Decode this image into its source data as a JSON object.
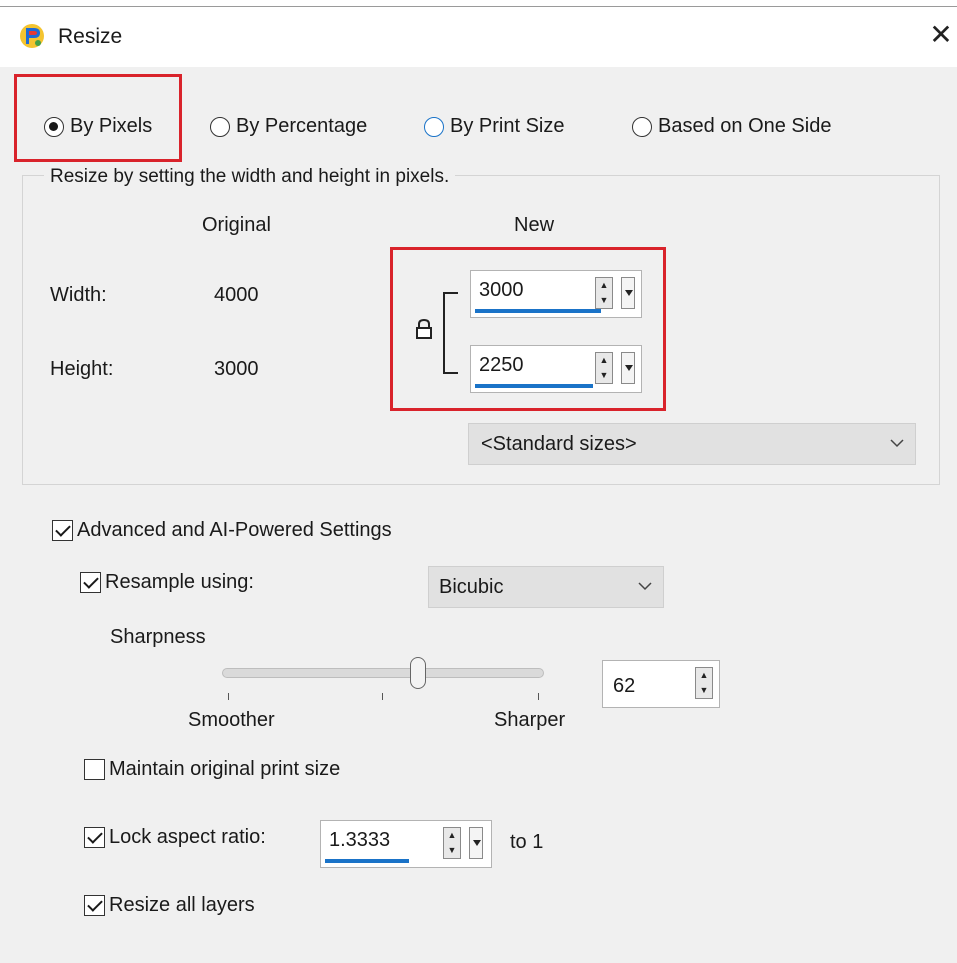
{
  "window": {
    "title": "Resize"
  },
  "modes": {
    "by_pixels": "By Pixels",
    "by_percentage": "By Percentage",
    "by_print_size": "By Print Size",
    "based_on_one_side": "Based on One Side",
    "selected": "By Pixels"
  },
  "pixel_group": {
    "legend": "Resize by setting the width and height in pixels.",
    "col_original": "Original",
    "col_new": "New",
    "width_label": "Width:",
    "height_label": "Height:",
    "original_width": "4000",
    "original_height": "3000",
    "new_width": "3000",
    "new_height": "2250",
    "standard_sizes": "<Standard sizes>"
  },
  "advanced": {
    "label": "Advanced and AI-Powered Settings",
    "checked": true,
    "resample_label": "Resample using:",
    "resample_checked": true,
    "resample_method": "Bicubic",
    "sharpness_label": "Sharpness",
    "smoother_label": "Smoother",
    "sharper_label": "Sharper",
    "sharpness_value": "62",
    "maintain_print_label": "Maintain original print size",
    "maintain_print_checked": false,
    "lock_aspect_label": "Lock aspect ratio:",
    "lock_aspect_checked": true,
    "aspect_value": "1.3333",
    "aspect_suffix": "to 1",
    "resize_layers_label": "Resize all layers",
    "resize_layers_checked": true
  },
  "colors": {
    "accent": "#1a73c8",
    "highlight_box": "#d9232b"
  }
}
